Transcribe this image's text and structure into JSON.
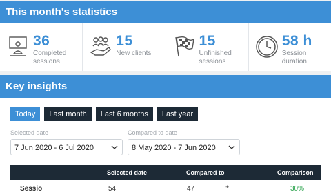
{
  "stats": {
    "title": "This month's statistics",
    "items": [
      {
        "value": "36",
        "label": "Completed sessions",
        "icon": "presentation-icon"
      },
      {
        "value": "15",
        "label": "New clients",
        "icon": "clients-hand-icon"
      },
      {
        "value": "15",
        "label": "Unfinished sessions",
        "icon": "checkered-flag-icon"
      },
      {
        "value": "58 h",
        "label": "Session duration",
        "icon": "clock-icon"
      }
    ]
  },
  "insights": {
    "title": "Key insights",
    "tabs": [
      "Today",
      "Last month",
      "Last 6 months",
      "Last year"
    ],
    "active_tab": "Today",
    "selected_date_label": "Selected date",
    "selected_date_value": "7 Jun 2020 - 6 Jul 2020",
    "compared_label": "Compared to date",
    "compared_value": "8 May 2020 - 7 Jun 2020",
    "table": {
      "headers": [
        "Selected date",
        "Compared to",
        "Comparison"
      ],
      "partial_row": {
        "c1": "Sessio",
        "c2": "54",
        "c3": "47",
        "c4": "30%"
      }
    }
  },
  "colors": {
    "accent": "#3d8fd6",
    "dark": "#1d2a36"
  }
}
